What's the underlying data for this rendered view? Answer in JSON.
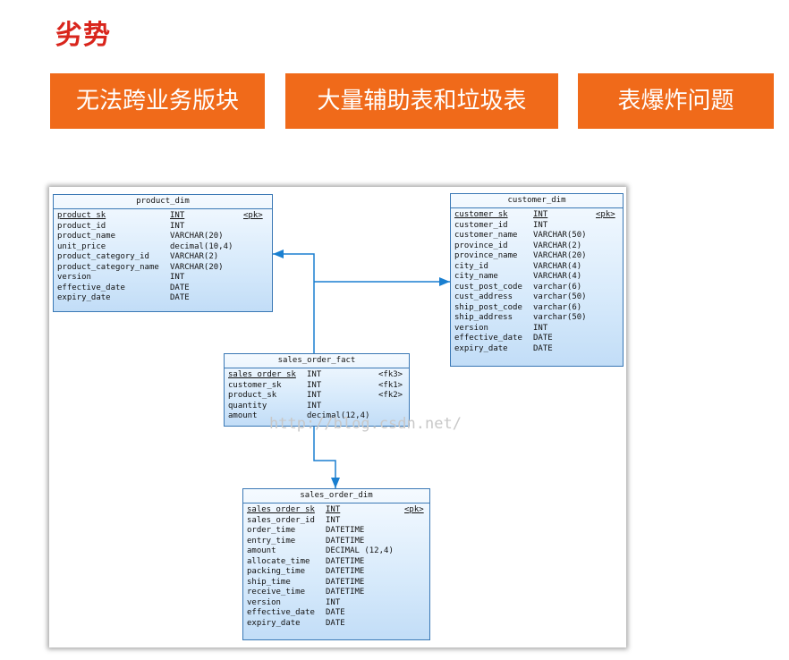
{
  "header": {
    "title": "劣势"
  },
  "banners": [
    {
      "label": "无法跨业务版块"
    },
    {
      "label": "大量辅助表和垃圾表"
    },
    {
      "label": "表爆炸问题"
    }
  ],
  "diagram": {
    "colors": {
      "border": "#3a78b5",
      "fill": "#d7eafb",
      "connector": "#1a7fd0"
    },
    "watermark": "http://blog.csdn.net/",
    "entities": {
      "product_dim": {
        "name": "product_dim",
        "columns": [
          {
            "name": "product_sk",
            "type": "INT",
            "key": "<pk>"
          },
          {
            "name": "product_id",
            "type": "INT",
            "key": ""
          },
          {
            "name": "product_name",
            "type": "VARCHAR(20)",
            "key": ""
          },
          {
            "name": "unit_price",
            "type": "decimal(10,4)",
            "key": ""
          },
          {
            "name": "product_category_id",
            "type": "VARCHAR(2)",
            "key": ""
          },
          {
            "name": "product_category_name",
            "type": "VARCHAR(20)",
            "key": ""
          },
          {
            "name": "version",
            "type": "INT",
            "key": ""
          },
          {
            "name": "effective_date",
            "type": "DATE",
            "key": ""
          },
          {
            "name": "expiry_date",
            "type": "DATE",
            "key": ""
          }
        ]
      },
      "customer_dim": {
        "name": "customer_dim",
        "columns": [
          {
            "name": "customer_sk",
            "type": "INT",
            "key": "<pk>"
          },
          {
            "name": "customer_id",
            "type": "INT",
            "key": ""
          },
          {
            "name": "customer_name",
            "type": "VARCHAR(50)",
            "key": ""
          },
          {
            "name": "province_id",
            "type": "VARCHAR(2)",
            "key": ""
          },
          {
            "name": "province_name",
            "type": "VARCHAR(20)",
            "key": ""
          },
          {
            "name": "city_id",
            "type": "VARCHAR(4)",
            "key": ""
          },
          {
            "name": "city_name",
            "type": "VARCHAR(4)",
            "key": ""
          },
          {
            "name": "cust_post_code",
            "type": "varchar(6)",
            "key": ""
          },
          {
            "name": "cust_address",
            "type": "varchar(50)",
            "key": ""
          },
          {
            "name": "ship_post_code",
            "type": "varchar(6)",
            "key": ""
          },
          {
            "name": "ship_address",
            "type": "varchar(50)",
            "key": ""
          },
          {
            "name": "version",
            "type": "INT",
            "key": ""
          },
          {
            "name": "effective_date",
            "type": "DATE",
            "key": ""
          },
          {
            "name": "expiry_date",
            "type": "DATE",
            "key": ""
          }
        ]
      },
      "sales_order_fact": {
        "name": "sales_order_fact",
        "columns": [
          {
            "name": "sales_order_sk",
            "type": "INT",
            "key": "<fk3>"
          },
          {
            "name": "customer_sk",
            "type": "INT",
            "key": "<fk1>"
          },
          {
            "name": "product_sk",
            "type": "INT",
            "key": "<fk2>"
          },
          {
            "name": "quantity",
            "type": "INT",
            "key": ""
          },
          {
            "name": "amount",
            "type": "decimal(12,4)",
            "key": ""
          }
        ]
      },
      "sales_order_dim": {
        "name": "sales_order_dim",
        "columns": [
          {
            "name": "sales_order_sk",
            "type": "INT",
            "key": "<pk>"
          },
          {
            "name": "sales_order_id",
            "type": "INT",
            "key": ""
          },
          {
            "name": "order_time",
            "type": "DATETIME",
            "key": ""
          },
          {
            "name": "entry_time",
            "type": "DATETIME",
            "key": ""
          },
          {
            "name": "amount",
            "type": "DECIMAL (12,4)",
            "key": ""
          },
          {
            "name": "allocate_time",
            "type": "DATETIME",
            "key": ""
          },
          {
            "name": "packing_time",
            "type": "DATETIME",
            "key": ""
          },
          {
            "name": "ship_time",
            "type": "DATETIME",
            "key": ""
          },
          {
            "name": "receive_time",
            "type": "DATETIME",
            "key": ""
          },
          {
            "name": "version",
            "type": "INT",
            "key": ""
          },
          {
            "name": "effective_date",
            "type": "DATE",
            "key": ""
          },
          {
            "name": "expiry_date",
            "type": "DATE",
            "key": ""
          }
        ]
      }
    }
  }
}
